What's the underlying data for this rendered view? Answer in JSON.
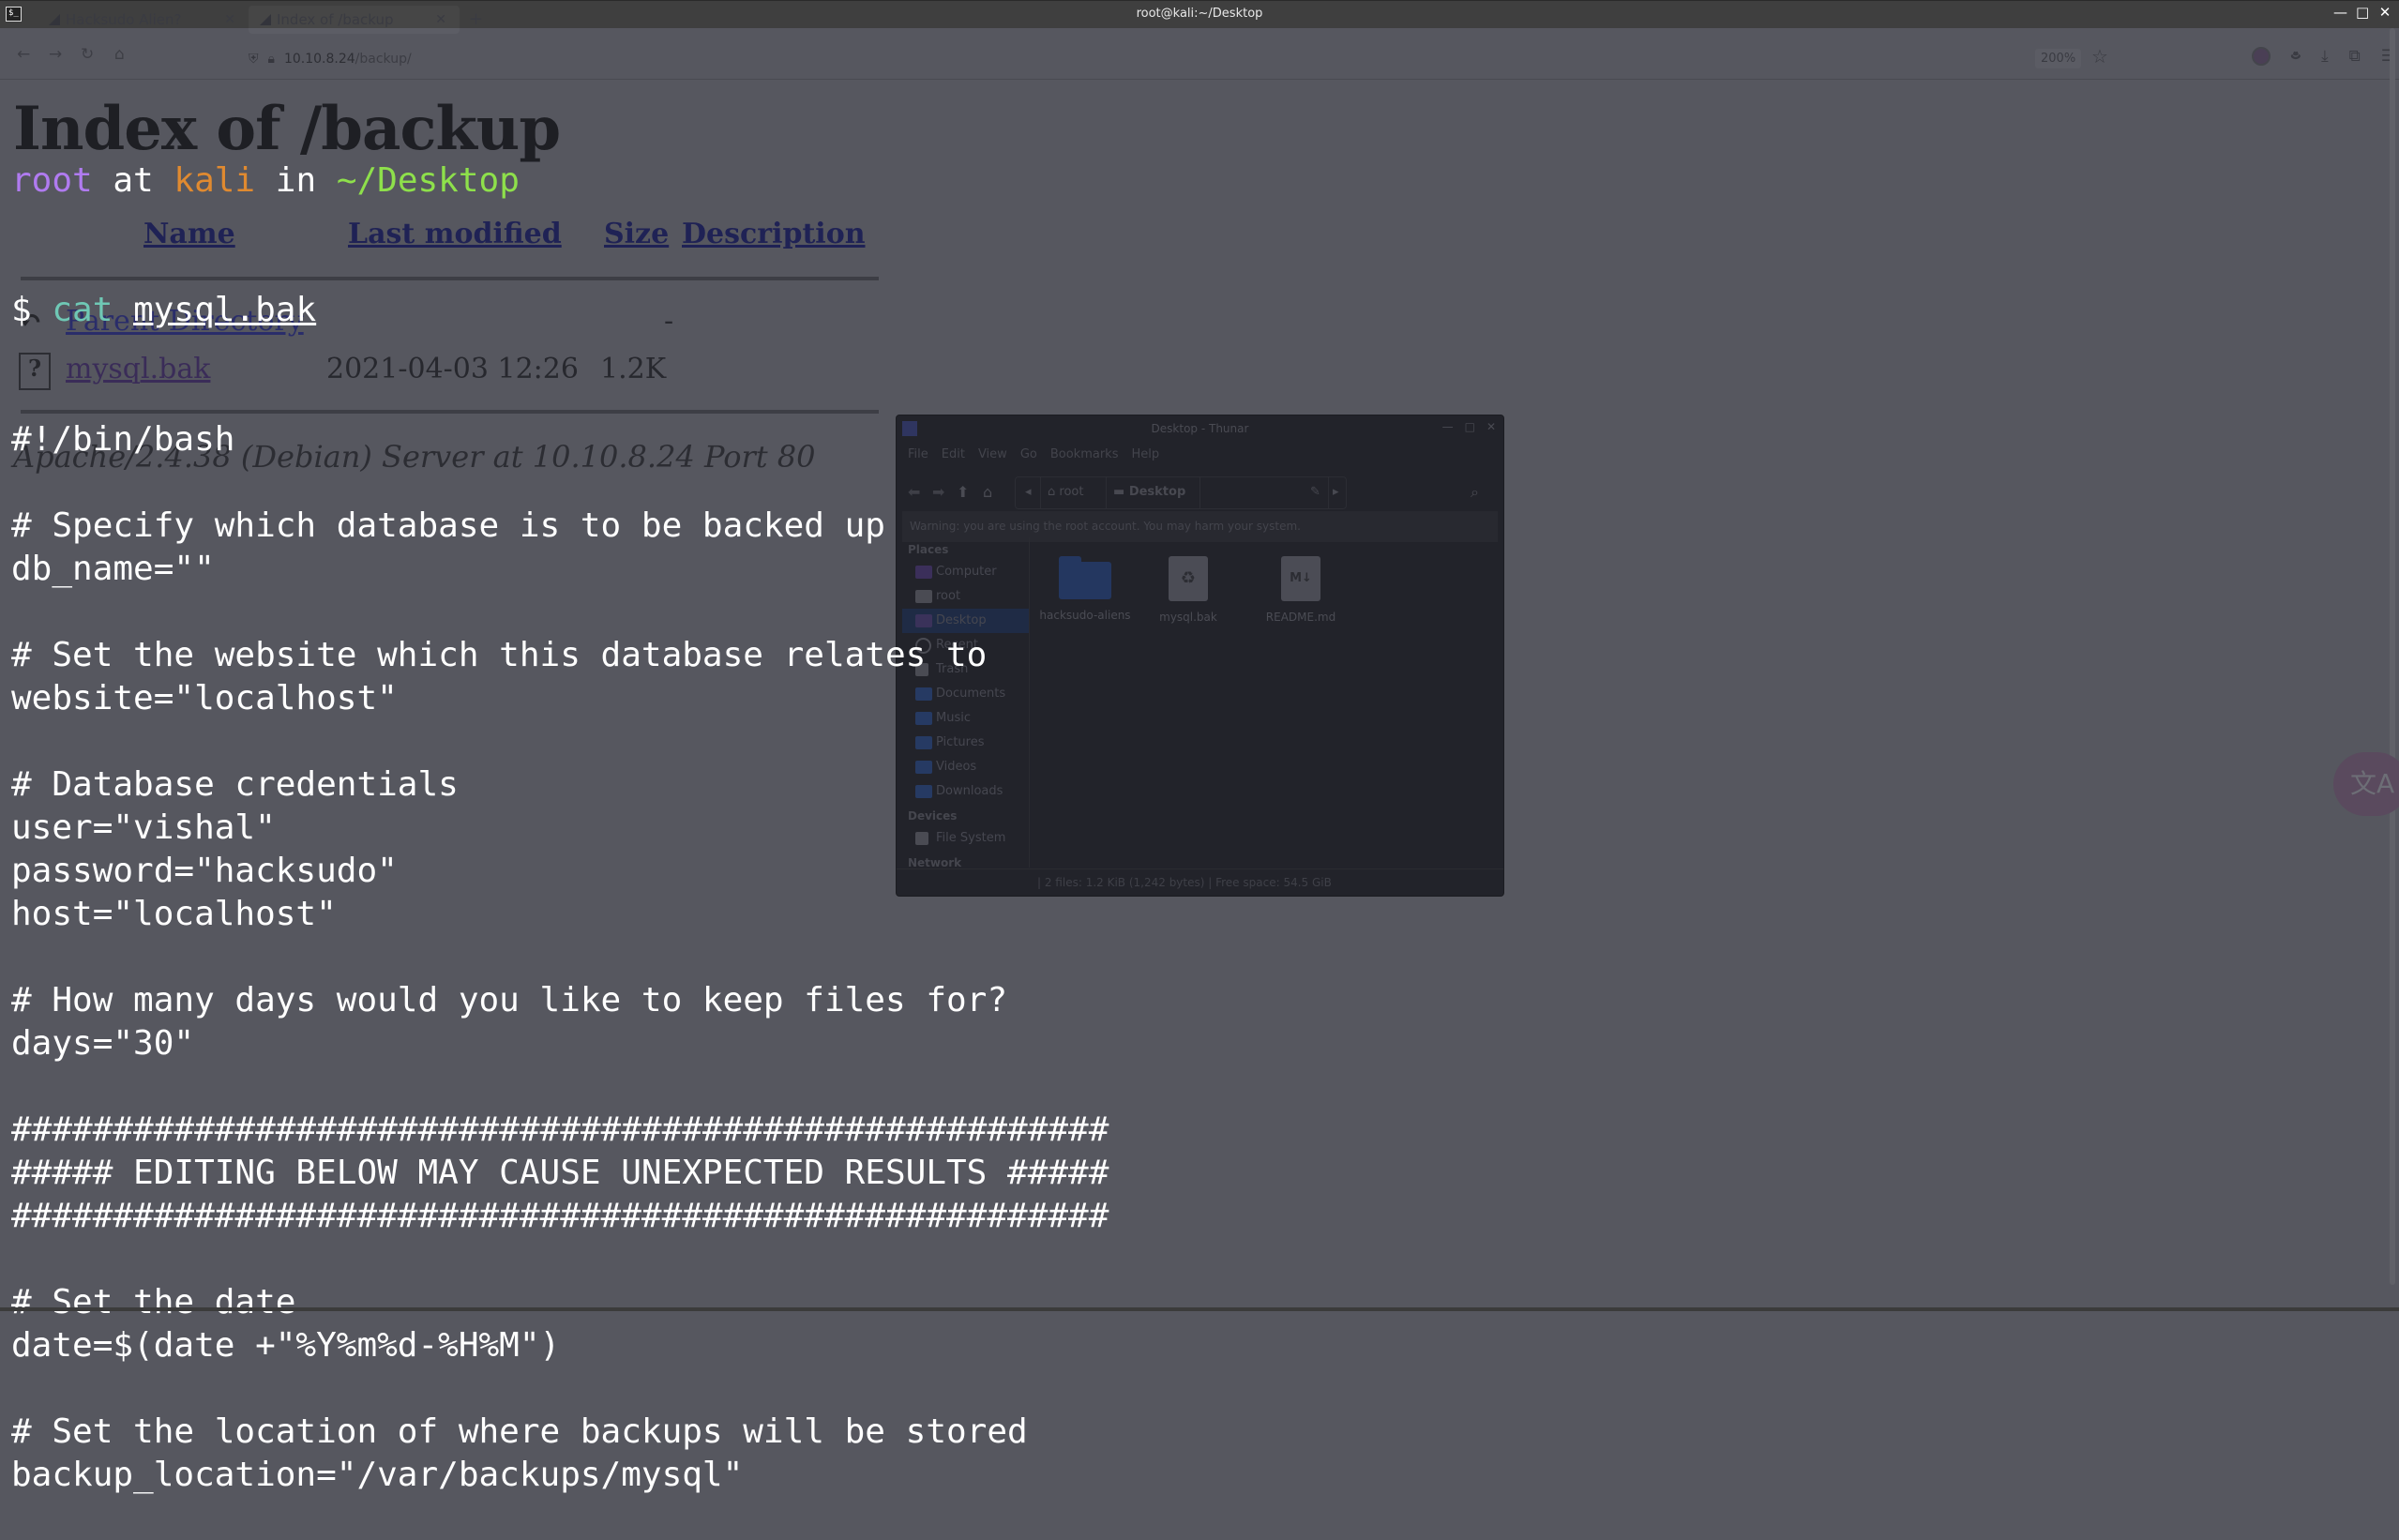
{
  "window": {
    "title": "root@kali:~/Desktop",
    "controls": {
      "minimize": "—",
      "maximize": "□",
      "close": "✕"
    }
  },
  "browser": {
    "tabs": [
      {
        "label": "Hacksudo Alien?",
        "active": false
      },
      {
        "label": "Index of /backup",
        "active": true
      }
    ],
    "new_tab": "+",
    "url_host": "10.10.8.24",
    "url_path": "/backup/",
    "zoom": "200%",
    "nav": {
      "back": "←",
      "forward": "→",
      "reload": "↻",
      "home": "⌂"
    },
    "page": {
      "title": "Index of /backup",
      "columns": [
        "Name",
        "Last modified",
        "Size",
        "Description"
      ],
      "rows": [
        {
          "name": "Parent Directory",
          "modified": "",
          "size": "-",
          "description": "",
          "icon": "back-arrow-icon"
        },
        {
          "name": "mysql.bak",
          "modified": "2021-04-03 12:26",
          "size": "1.2K",
          "description": "",
          "icon": "unknown-file-icon"
        }
      ],
      "footer": "Apache/2.4.38 (Debian) Server at 10.10.8.24 Port 80"
    }
  },
  "terminal": {
    "prompt": {
      "user": "root",
      "at": " at ",
      "host": "kali",
      "in": " in ",
      "path": "~/Desktop"
    },
    "command": {
      "dollar": "$ ",
      "cmd": "cat",
      "arg": "mysql.bak"
    },
    "output": [
      "#!/bin/bash",
      "",
      "# Specify which database is to be backed up",
      "db_name=\"\"",
      "",
      "# Set the website which this database relates to",
      "website=\"localhost\"",
      "",
      "# Database credentials",
      "user=\"vishal\"",
      "password=\"hacksudo\"",
      "host=\"localhost\"",
      "",
      "# How many days would you like to keep files for?",
      "days=\"30\"",
      "",
      "######################################################",
      "##### EDITING BELOW MAY CAUSE UNEXPECTED RESULTS #####",
      "######################################################",
      "",
      "# Set the date",
      "date=$(date +\"%Y%m%d-%H%M\")",
      "",
      "# Set the location of where backups will be stored",
      "backup_location=\"/var/backups/mysql\""
    ]
  },
  "thunar": {
    "title": "Desktop - Thunar",
    "menu": [
      "File",
      "Edit",
      "View",
      "Go",
      "Bookmarks",
      "Help"
    ],
    "path": [
      "root",
      "Desktop"
    ],
    "warning": "Warning: you are using the root account. You may harm your system.",
    "sidebar": {
      "places_header": "Places",
      "places": [
        {
          "label": "Computer",
          "icon": "computer-icon"
        },
        {
          "label": "root",
          "icon": "home-folder-icon"
        },
        {
          "label": "Desktop",
          "icon": "desktop-icon",
          "selected": true
        },
        {
          "label": "Recent",
          "icon": "clock-icon"
        },
        {
          "label": "Trash",
          "icon": "trash-icon"
        },
        {
          "label": "Documents",
          "icon": "documents-folder-icon"
        },
        {
          "label": "Music",
          "icon": "music-folder-icon"
        },
        {
          "label": "Pictures",
          "icon": "pictures-folder-icon"
        },
        {
          "label": "Videos",
          "icon": "videos-folder-icon"
        },
        {
          "label": "Downloads",
          "icon": "downloads-folder-icon"
        }
      ],
      "devices_header": "Devices",
      "devices": [
        {
          "label": "File System",
          "icon": "drive-icon"
        }
      ],
      "network_header": "Network"
    },
    "files": [
      {
        "name": "hacksudo-aliens",
        "type": "folder"
      },
      {
        "name": "mysql.bak",
        "type": "backup"
      },
      {
        "name": "README.md",
        "type": "markdown"
      }
    ],
    "status": "2 files: 1.2 KiB (1,242 bytes)  |  Free space: 54.5 GiB",
    "status_prefix": "| "
  },
  "translate_button": "文A"
}
